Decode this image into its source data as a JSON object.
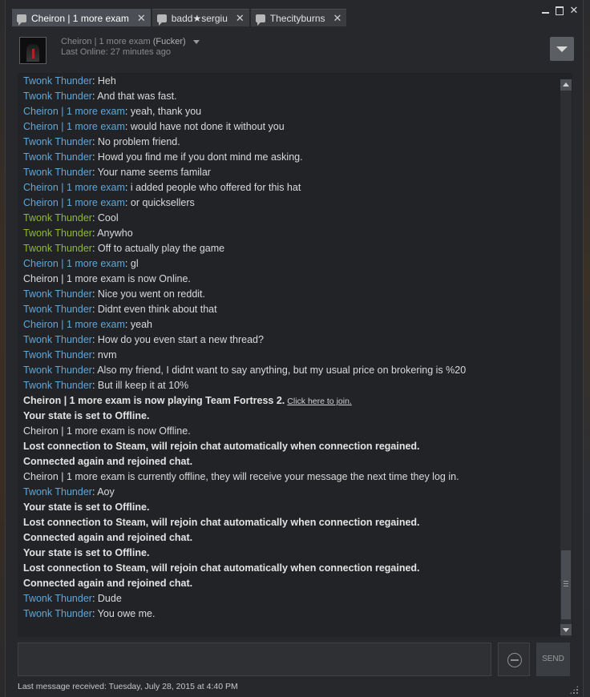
{
  "tabs": [
    {
      "label": "Cheiron | 1 more exam",
      "active": true
    },
    {
      "label": "badd★sergiu",
      "active": false
    },
    {
      "label": "Thecityburns",
      "active": false
    }
  ],
  "header": {
    "name": "Cheiron | 1 more exam",
    "nickname": "(Fucker)",
    "last_online": "Last Online: 27 minutes ago"
  },
  "messages": [
    {
      "type": "chat",
      "color": "blue",
      "sender": "Twonk Thunder",
      "text": "Heh"
    },
    {
      "type": "chat",
      "color": "blue",
      "sender": "Twonk Thunder",
      "text": "And that was fast."
    },
    {
      "type": "chat",
      "color": "blue",
      "sender": "Cheiron | 1 more exam",
      "text": "yeah, thank you"
    },
    {
      "type": "chat",
      "color": "blue",
      "sender": "Cheiron | 1 more exam",
      "text": "would have not done it without you"
    },
    {
      "type": "chat",
      "color": "blue",
      "sender": "Twonk Thunder",
      "text": "No problem friend."
    },
    {
      "type": "chat",
      "color": "blue",
      "sender": "Twonk Thunder",
      "text": "Howd you find me if you dont mind me asking."
    },
    {
      "type": "chat",
      "color": "blue",
      "sender": "Twonk Thunder",
      "text": "Your name seems familar"
    },
    {
      "type": "chat",
      "color": "blue",
      "sender": "Cheiron | 1 more exam",
      "text": "i added people who offered for this hat"
    },
    {
      "type": "chat",
      "color": "blue",
      "sender": "Cheiron | 1 more exam",
      "text": "or quicksellers"
    },
    {
      "type": "chat",
      "color": "green",
      "sender": "Twonk Thunder",
      "text": "Cool"
    },
    {
      "type": "chat",
      "color": "green",
      "sender": "Twonk Thunder",
      "text": "Anywho"
    },
    {
      "type": "chat",
      "color": "green",
      "sender": "Twonk Thunder",
      "text": "Off to actually play the game"
    },
    {
      "type": "chat",
      "color": "blue",
      "sender": "Cheiron | 1 more exam",
      "text": "gl"
    },
    {
      "type": "status",
      "text": "Cheiron | 1 more exam is now Online."
    },
    {
      "type": "chat",
      "color": "blue",
      "sender": "Twonk Thunder",
      "text": "Nice you went on reddit."
    },
    {
      "type": "chat",
      "color": "blue",
      "sender": "Twonk Thunder",
      "text": "Didnt even think about that"
    },
    {
      "type": "chat",
      "color": "blue",
      "sender": "Cheiron | 1 more exam",
      "text": "yeah"
    },
    {
      "type": "chat",
      "color": "blue",
      "sender": "Twonk Thunder",
      "text": "How do you even start a new thread?"
    },
    {
      "type": "chat",
      "color": "blue",
      "sender": "Twonk Thunder",
      "text": "nvm"
    },
    {
      "type": "chat",
      "color": "blue",
      "sender": "Twonk Thunder",
      "text": "Also my friend, I didnt want to say anything, but my usual price on brokering is %20"
    },
    {
      "type": "chat",
      "color": "blue",
      "sender": "Twonk Thunder",
      "text": "But ill keep it at 10%"
    },
    {
      "type": "bold",
      "text": "Cheiron | 1 more exam is now playing Team Fortress 2.",
      "link": "Click here to join."
    },
    {
      "type": "bold",
      "text": "Your state is set to Offline."
    },
    {
      "type": "status",
      "text": "Cheiron | 1 more exam is now Offline."
    },
    {
      "type": "bold",
      "text": "Lost connection to Steam, will rejoin chat automatically when connection regained."
    },
    {
      "type": "bold",
      "text": "Connected again and rejoined chat."
    },
    {
      "type": "status",
      "text": "Cheiron | 1 more exam is currently offline, they will receive your message the next time they log in."
    },
    {
      "type": "chat",
      "color": "blue",
      "sender": "Twonk Thunder",
      "text": "Aoy"
    },
    {
      "type": "bold",
      "text": "Your state is set to Offline."
    },
    {
      "type": "bold",
      "text": "Lost connection to Steam, will rejoin chat automatically when connection regained."
    },
    {
      "type": "bold",
      "text": "Connected again and rejoined chat."
    },
    {
      "type": "bold",
      "text": "Your state is set to Offline."
    },
    {
      "type": "bold",
      "text": "Lost connection to Steam, will rejoin chat automatically when connection regained."
    },
    {
      "type": "bold",
      "text": "Connected again and rejoined chat."
    },
    {
      "type": "chat",
      "color": "blue",
      "sender": "Twonk Thunder",
      "text": "Dude"
    },
    {
      "type": "chat",
      "color": "blue",
      "sender": "Twonk Thunder",
      "text": "You owe me."
    }
  ],
  "input": {
    "value": "",
    "placeholder": ""
  },
  "send_label": "SEND",
  "footer": "Last message received: Tuesday, July 28, 2015 at 4:40 PM",
  "colors": {
    "sender_blue": "#62a6d6",
    "sender_green": "#8fb934",
    "background": "#222327"
  }
}
